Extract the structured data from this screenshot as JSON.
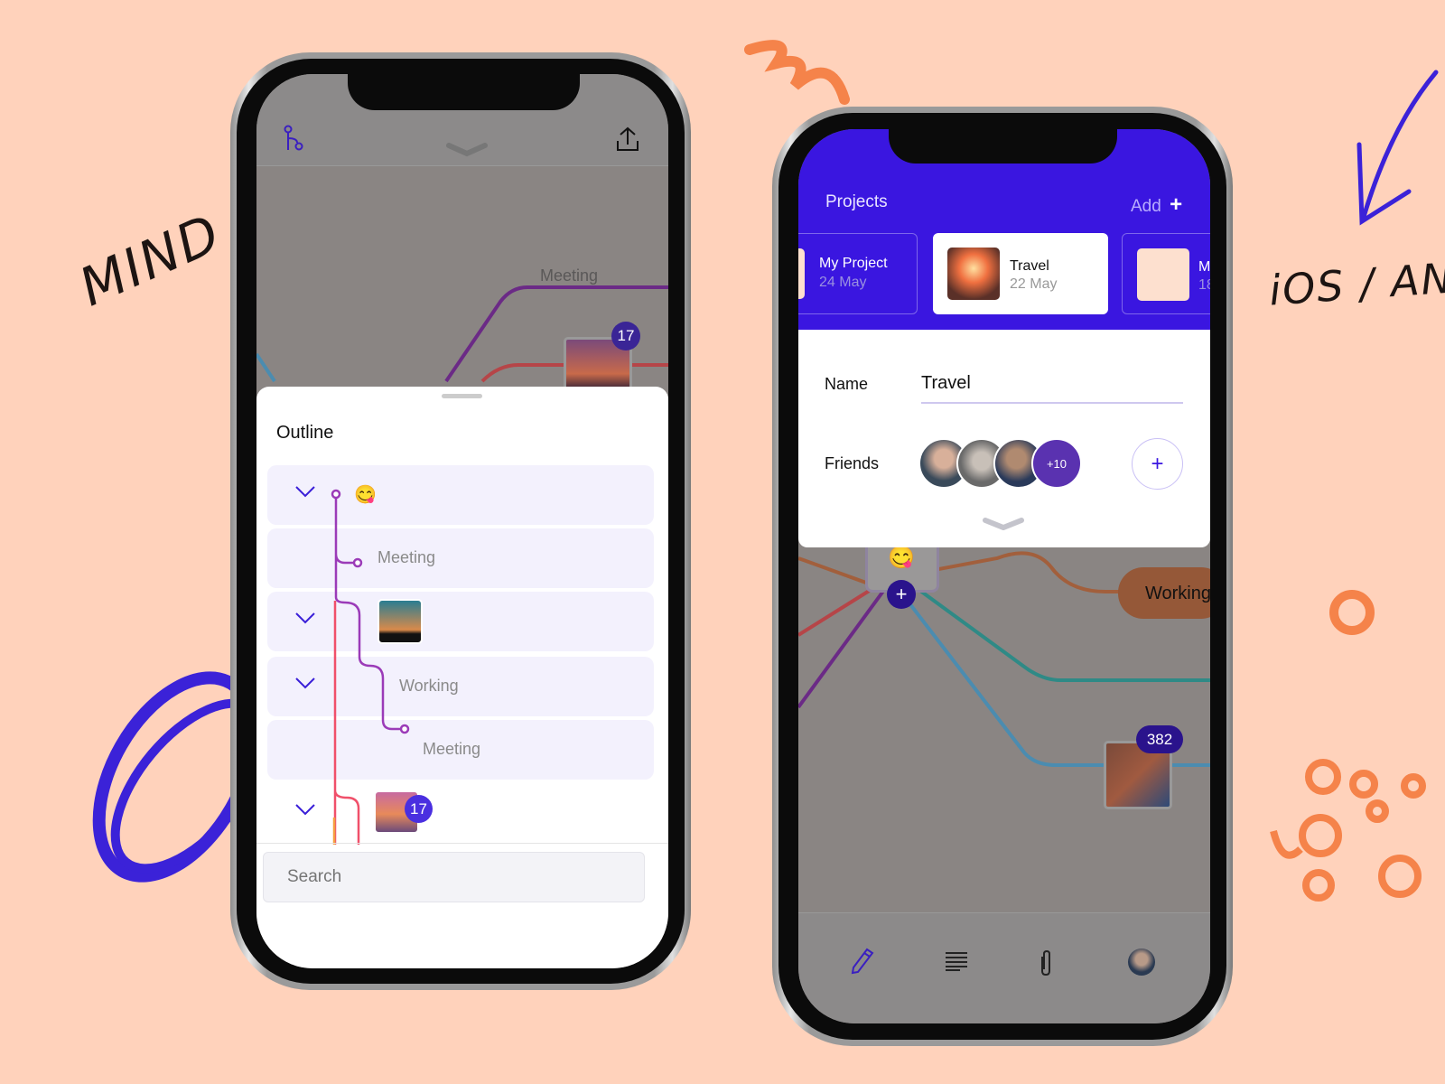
{
  "decor": {
    "left_caption": "MIND AP",
    "right_caption": "iOS / ANDR"
  },
  "colors": {
    "accent": "#3a16e0",
    "background": "#ffd2bb",
    "map_bg": "#8a8583",
    "scribble_blue": "#3b22d8",
    "scribble_orange": "#f5834a"
  },
  "left_phone": {
    "header": {
      "left_icon": "branch-icon",
      "center_icon": "chevron-down-icon",
      "right_icon": "share-icon"
    },
    "map": {
      "node_label": "Meeting",
      "photo_badge": "17"
    },
    "outline": {
      "title": "Outline",
      "rows": [
        {
          "expandable": true,
          "content": "emoji",
          "emoji": "😋"
        },
        {
          "expandable": false,
          "label": "Meeting"
        },
        {
          "expandable": true,
          "content": "photo"
        },
        {
          "expandable": true,
          "label": "Working"
        },
        {
          "expandable": false,
          "label": "Meeting"
        },
        {
          "expandable": true,
          "content": "photo",
          "badge": "17"
        }
      ],
      "search_placeholder": "Search"
    }
  },
  "right_phone": {
    "header": {
      "title": "Projects",
      "add_label": "Add",
      "add_icon": "plus-icon"
    },
    "projects": [
      {
        "name": "My Project",
        "date": "24 May",
        "selected": false
      },
      {
        "name": "Travel",
        "date": "22 May",
        "selected": true
      },
      {
        "name": "M",
        "date": "18",
        "selected": false
      }
    ],
    "form": {
      "name_label": "Name",
      "name_value": "Travel",
      "friends_label": "Friends",
      "friends_more": "+10",
      "add_friend_icon": "plus-icon"
    },
    "map": {
      "emoji": "😋",
      "node_label": "Working",
      "photo_badge": "382"
    },
    "toolbar": [
      {
        "icon": "pencil-icon",
        "active": true
      },
      {
        "icon": "text-lines-icon",
        "active": false
      },
      {
        "icon": "paperclip-icon",
        "active": false
      },
      {
        "icon": "profile-avatar",
        "active": false
      }
    ]
  }
}
